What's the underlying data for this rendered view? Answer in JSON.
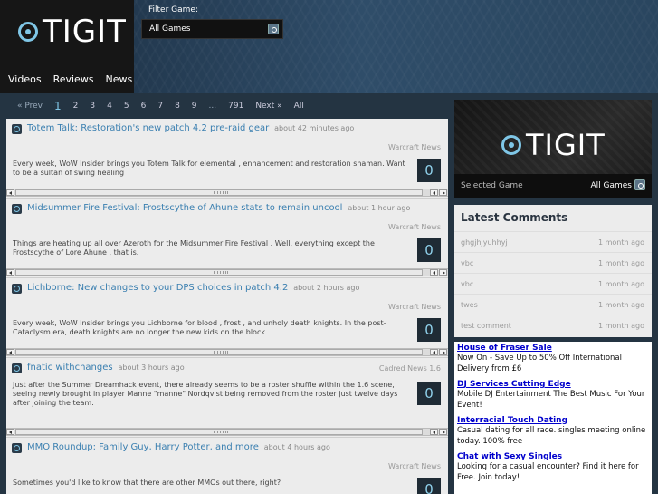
{
  "header": {
    "logo_text": "TIGIT",
    "nav": [
      "Videos",
      "Reviews",
      "News"
    ],
    "filter_label": "Filter Game:",
    "filter_value": "All Games"
  },
  "pagination": {
    "prev": "« Prev",
    "pages": [
      "1",
      "2",
      "3",
      "4",
      "5",
      "6",
      "7",
      "8",
      "9"
    ],
    "current": "1",
    "ellipsis": "...",
    "last": "791",
    "next": "Next »",
    "all": "All"
  },
  "feed": [
    {
      "title": "Totem Talk: Restoration's new patch 4.2 pre-raid gear",
      "time": "about 42 minutes ago",
      "source": "Warcraft News",
      "summary": "Every week, WoW Insider brings you Totem Talk for elemental , enhancement and restoration shaman. Want to be a sultan of swing healing",
      "count": "0"
    },
    {
      "title": "Midsummer Fire Festival: Frostscythe of Ahune stats to remain uncool",
      "time": "about 1 hour ago",
      "source": "Warcraft News",
      "summary": "Things are heating up all over Azeroth for the Midsummer Fire Festival . Well, everything except the Frostscythe of Lore Ahune , that is.",
      "count": "0"
    },
    {
      "title": "Lichborne: New changes to your DPS choices in patch 4.2",
      "time": "about 2 hours ago",
      "source": "Warcraft News",
      "summary": "Every week, WoW Insider brings you Lichborne for blood , frost , and unholy death knights. In the post-Cataclysm era, death knights are no longer the new kids on the block",
      "count": "0"
    },
    {
      "title": "fnatic withchanges",
      "time": "about 3 hours ago",
      "source": "Cadred News 1.6",
      "summary": "Just after the Summer Dreamhack event, there already seems to be a roster shuffle within the 1.6 scene, seeing newly brought in player Manne \"manne\" Nordqvist being removed from the roster just twelve days after joining the team.",
      "count": "0"
    },
    {
      "title": "MMO Roundup: Family Guy, Harry Potter, and more",
      "time": "about 4 hours ago",
      "source": "Warcraft News",
      "summary": "Sometimes you'd like to know that there are other MMOs out there, right?",
      "count": "0"
    }
  ],
  "sidebar": {
    "logo_text": "TIGIT",
    "selected_label": "Selected Game",
    "selected_value": "All Games",
    "comments_title": "Latest Comments",
    "comments": [
      {
        "who": "ghgjhjyuhhyj",
        "when": "1 month ago"
      },
      {
        "who": "vbc",
        "when": "1 month ago"
      },
      {
        "who": "vbc",
        "when": "1 month ago"
      },
      {
        "who": "twes",
        "when": "1 month ago"
      },
      {
        "who": "test comment",
        "when": "1 month ago"
      }
    ],
    "ads": [
      {
        "title": "House of Fraser Sale",
        "text": "Now On - Save Up to 50% Off International Delivery from £6"
      },
      {
        "title": "DJ Services Cutting Edge",
        "text": "Mobile DJ Entertainment The Best Music For Your Event!"
      },
      {
        "title": "Interracial Touch Dating",
        "text": "Casual dating for all race. singles meeting online today. 100% free"
      },
      {
        "title": "Chat with Sexy Singles",
        "text": "Looking for a casual encounter? Find it here for Free. Join today!"
      }
    ]
  },
  "colors": {
    "accent": "#7fc6e6",
    "link": "#3a7fb0",
    "ad_link": "#0000cc"
  }
}
